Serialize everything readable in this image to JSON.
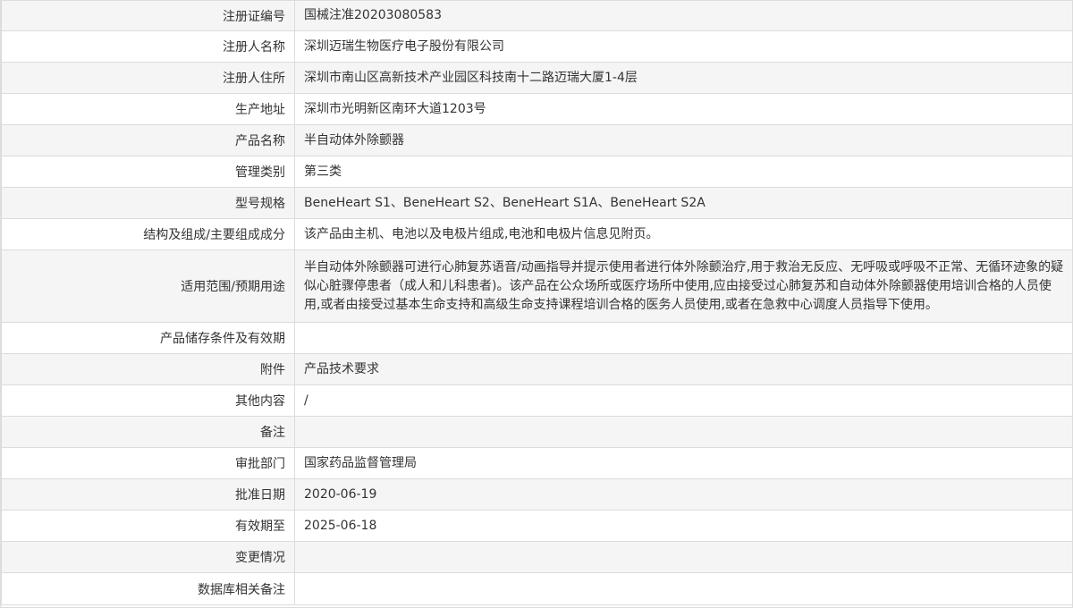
{
  "rows": [
    {
      "label": "注册证编号",
      "value": "国械注准20203080583"
    },
    {
      "label": "注册人名称",
      "value": "深圳迈瑞生物医疗电子股份有限公司"
    },
    {
      "label": "注册人住所",
      "value": "深圳市南山区高新技术产业园区科技南十二路迈瑞大厦1-4层"
    },
    {
      "label": "生产地址",
      "value": "深圳市光明新区南环大道1203号"
    },
    {
      "label": "产品名称",
      "value": "半自动体外除颤器"
    },
    {
      "label": "管理类别",
      "value": "第三类"
    },
    {
      "label": "型号规格",
      "value": "BeneHeart S1、BeneHeart S2、BeneHeart S1A、BeneHeart S2A"
    },
    {
      "label": "结构及组成/主要组成成分",
      "value": "该产品由主机、电池以及电极片组成,电池和电极片信息见附页。"
    },
    {
      "label": "适用范围/预期用途",
      "value": "半自动体外除颤器可进行心肺复苏语音/动画指导并提示使用者进行体外除颤治疗,用于救治无反应、无呼吸或呼吸不正常、无循环迹象的疑似心脏骤停患者（成人和儿科患者)。该产品在公众场所或医疗场所中使用,应由接受过心肺复苏和自动体外除颤器使用培训合格的人员使用,或者由接受过基本生命支持和高级生命支持课程培训合格的医务人员使用,或者在急救中心调度人员指导下使用。"
    },
    {
      "label": "产品储存条件及有效期",
      "value": ""
    },
    {
      "label": "附件",
      "value": "产品技术要求"
    },
    {
      "label": "其他内容",
      "value": "/"
    },
    {
      "label": "备注",
      "value": ""
    },
    {
      "label": "审批部门",
      "value": "国家药品监督管理局"
    },
    {
      "label": "批准日期",
      "value": "2020-06-19"
    },
    {
      "label": "有效期至",
      "value": "2025-06-18"
    },
    {
      "label": "变更情况",
      "value": ""
    },
    {
      "label": "数据库相关备注",
      "value": ""
    }
  ]
}
